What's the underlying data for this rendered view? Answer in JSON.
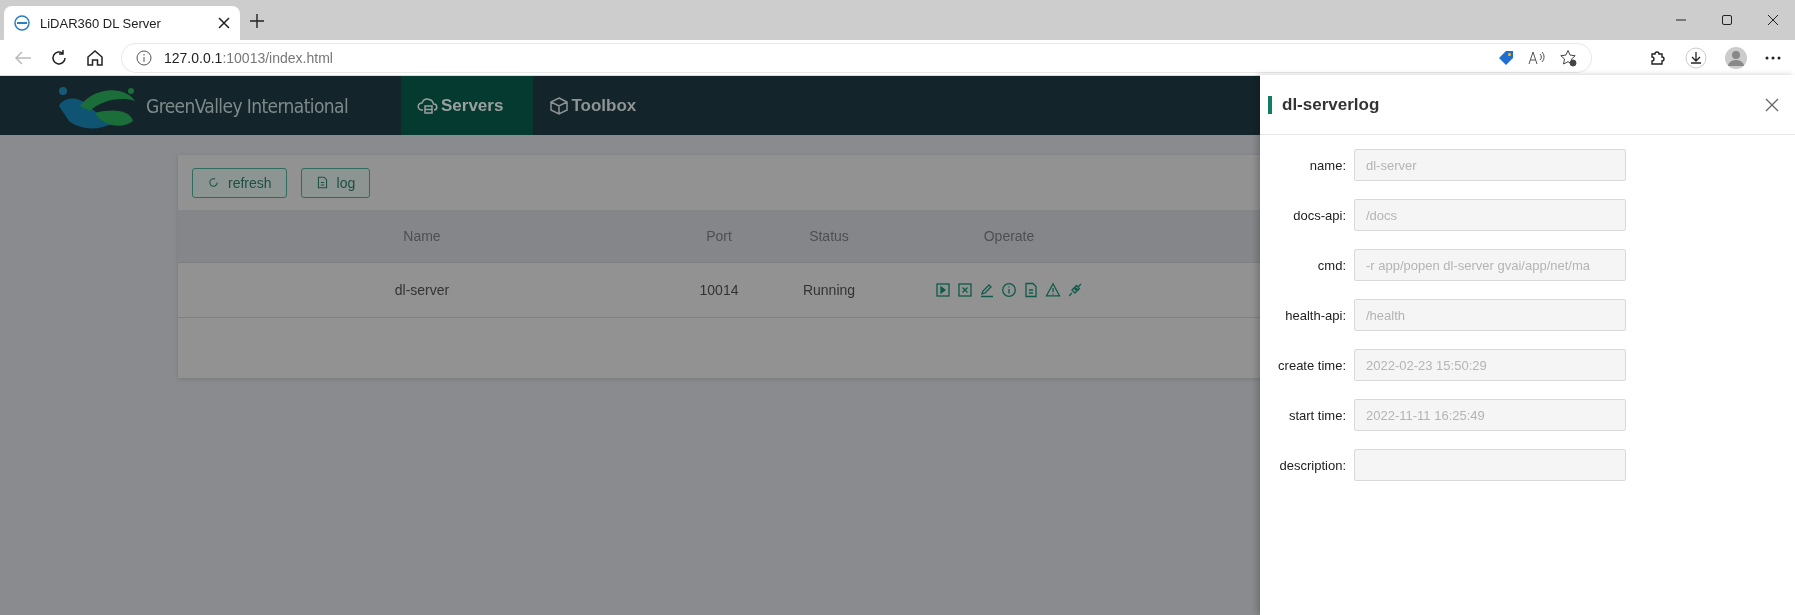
{
  "browser": {
    "tab": {
      "title": "LiDAR360 DL Server"
    },
    "url": {
      "host": "127.0.0.1",
      "path": ":10013/index.html"
    }
  },
  "header": {
    "logo": {
      "text": "GreenValley International"
    },
    "nav": [
      {
        "label": "Servers",
        "kind": "servers",
        "selected": true
      },
      {
        "label": "Toolbox",
        "kind": "toolbox",
        "selected": false
      }
    ]
  },
  "toolbar": {
    "buttons": [
      {
        "label": "refresh",
        "kind": "refresh"
      },
      {
        "label": "log",
        "kind": "log"
      }
    ]
  },
  "table": {
    "columns": [
      "Name",
      "Port",
      "Status",
      "Operate"
    ],
    "rows": [
      {
        "name": "dl-server",
        "port": "10014",
        "status": "Running",
        "actions": [
          {
            "kind": "start"
          },
          {
            "kind": "stop"
          },
          {
            "kind": "edit"
          },
          {
            "kind": "info"
          },
          {
            "kind": "log"
          },
          {
            "kind": "warning"
          },
          {
            "kind": "connect"
          }
        ]
      }
    ]
  },
  "drawer": {
    "title": "dl-serverlog",
    "fields": [
      {
        "label": "name:",
        "value": "dl-server",
        "disabled": true
      },
      {
        "label": "docs-api:",
        "value": "/docs",
        "disabled": true
      },
      {
        "label": "cmd:",
        "value": "-r app/popen dl-server gvai/app/net/ma",
        "disabled": true
      },
      {
        "label": "health-api:",
        "value": "/health",
        "disabled": true
      },
      {
        "label": "create time:",
        "value": "2022-02-23 15:50:29",
        "disabled": true
      },
      {
        "label": "start time:",
        "value": "2022-11-11 16:25:49",
        "disabled": true
      },
      {
        "label": "description:",
        "disabled": true
      }
    ]
  }
}
